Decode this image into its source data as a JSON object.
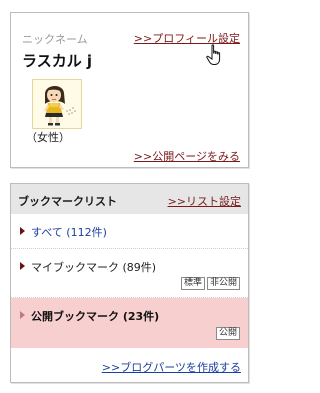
{
  "profile": {
    "nickname_label": "ニックネーム",
    "profile_settings_link": ">>プロフィール設定",
    "username": "ラスカル j",
    "gender": "（女性）",
    "public_page_link": ">>公開ページをみる",
    "avatar_icon": "girl-avatar-icon",
    "cursor_icon": "hand-pointer-icon"
  },
  "bookmark_list": {
    "title": "ブックマークリスト",
    "settings_link": ">>リスト設定",
    "items": [
      {
        "label": "すべて (112件)",
        "badges": []
      },
      {
        "label": "マイブックマーク (89件)",
        "badges": [
          "標準",
          "非公開"
        ]
      },
      {
        "label": "公開ブックマーク (23件)",
        "badges": [
          "公開"
        ]
      }
    ],
    "footer_link": ">>ブログパーツを作成する"
  },
  "colors": {
    "link_dark_red": "#7a1a1a",
    "link_blue": "#1b3fa0",
    "header_gray": "#e6e6e6",
    "highlight_pink": "#f7cfcf"
  }
}
